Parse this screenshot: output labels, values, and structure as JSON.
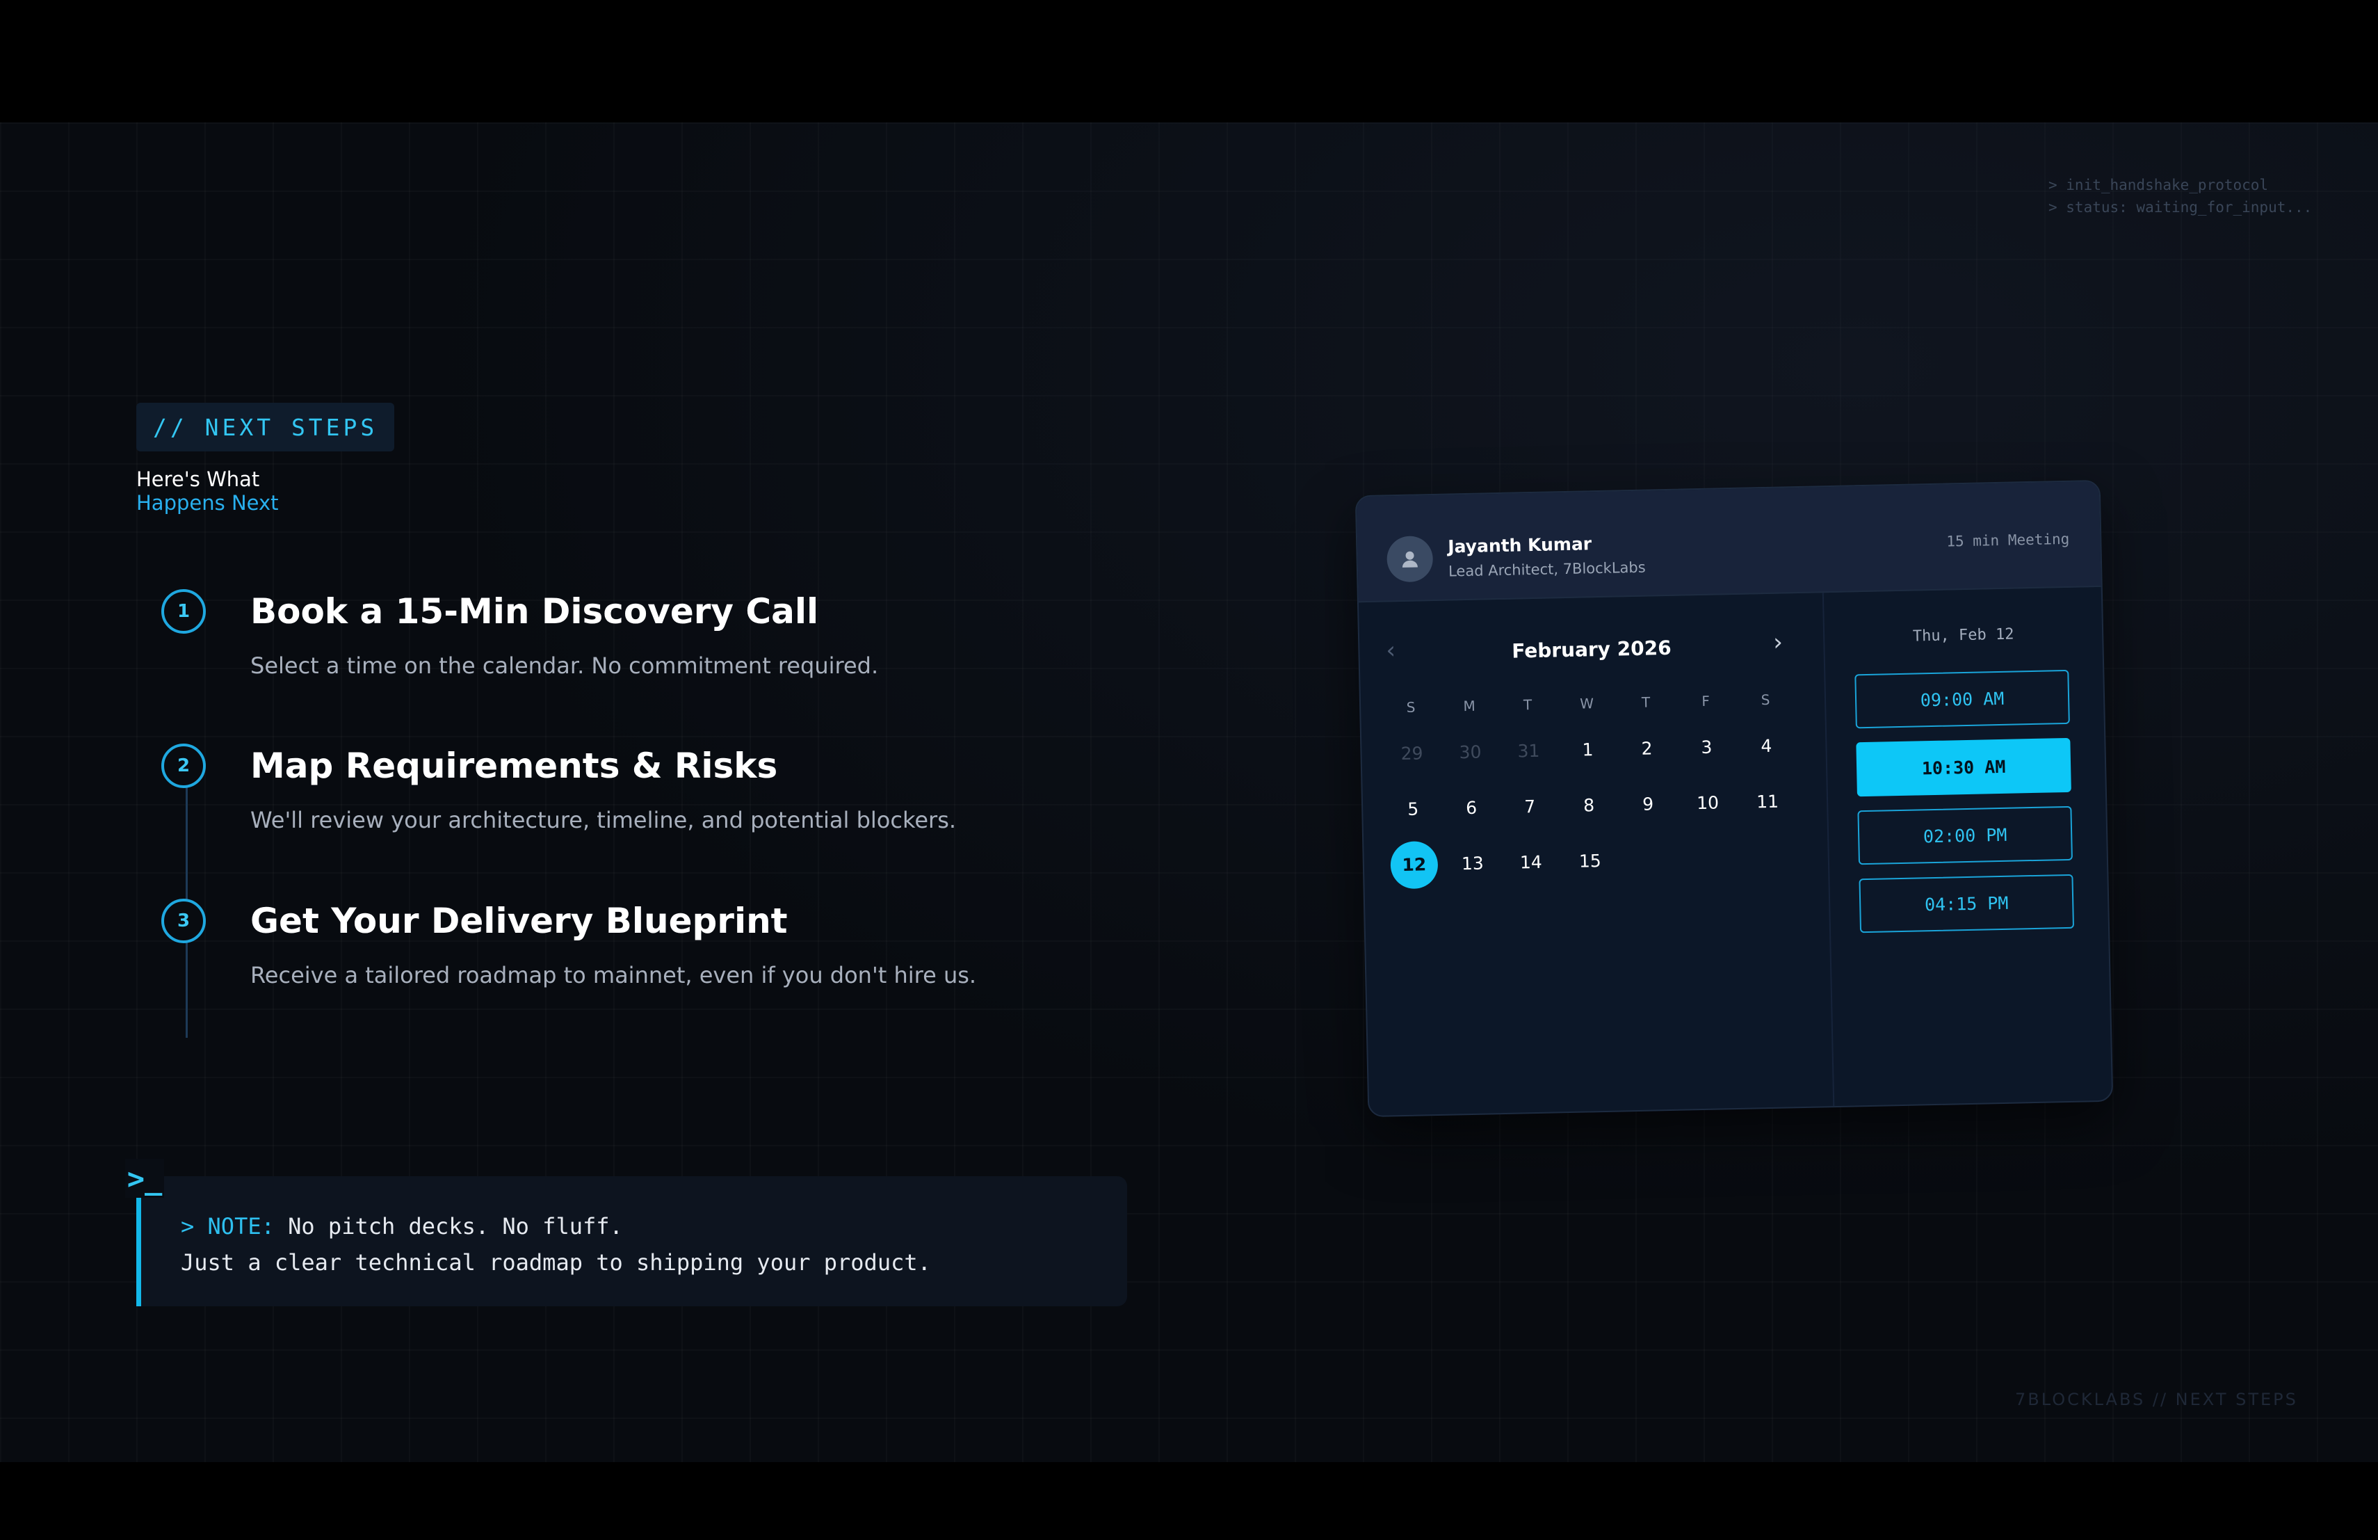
{
  "terminal": {
    "line1": "> init_handshake_protocol",
    "line2": "> status: waiting_for_input..."
  },
  "section": {
    "badge": "// NEXT STEPS",
    "heading_line1": "Here's What",
    "heading_line2": "Happens Next"
  },
  "steps": [
    {
      "number": "1",
      "title": "Book a 15-Min Discovery Call",
      "description": "Select a time on the calendar. No commitment required."
    },
    {
      "number": "2",
      "title": "Map Requirements & Risks",
      "description": "We'll review your architecture, timeline, and potential blockers."
    },
    {
      "number": "3",
      "title": "Get Your Delivery Blueprint",
      "description": "Receive a tailored roadmap to mainnet, even if you don't hire us."
    }
  ],
  "note": {
    "icon": ">_",
    "tag": "> NOTE:",
    "line1": " No pitch decks. No fluff.",
    "line2": "Just a clear technical roadmap to shipping your product."
  },
  "booking": {
    "host_name": "Jayanth Kumar",
    "host_role": "Lead Architect, 7BlockLabs",
    "meeting_length": "15 min Meeting",
    "month": "February 2026",
    "weekdays": [
      "S",
      "M",
      "T",
      "W",
      "T",
      "F",
      "S"
    ],
    "days": [
      "29",
      "30",
      "31",
      "1",
      "2",
      "3",
      "4",
      "5",
      "6",
      "7",
      "8",
      "9",
      "10",
      "11",
      "12",
      "13",
      "14",
      "15"
    ],
    "selected_date": "Thu, Feb 12",
    "slots": [
      "09:00 AM",
      "10:30 AM",
      "02:00 PM",
      "04:15 PM"
    ],
    "selected_slot": "10:30 AM"
  },
  "footer": "7BLOCKLABS // NEXT STEPS",
  "colors": {
    "accent": "#12c4f4",
    "background": "#080b10",
    "card": "#0c1728"
  }
}
